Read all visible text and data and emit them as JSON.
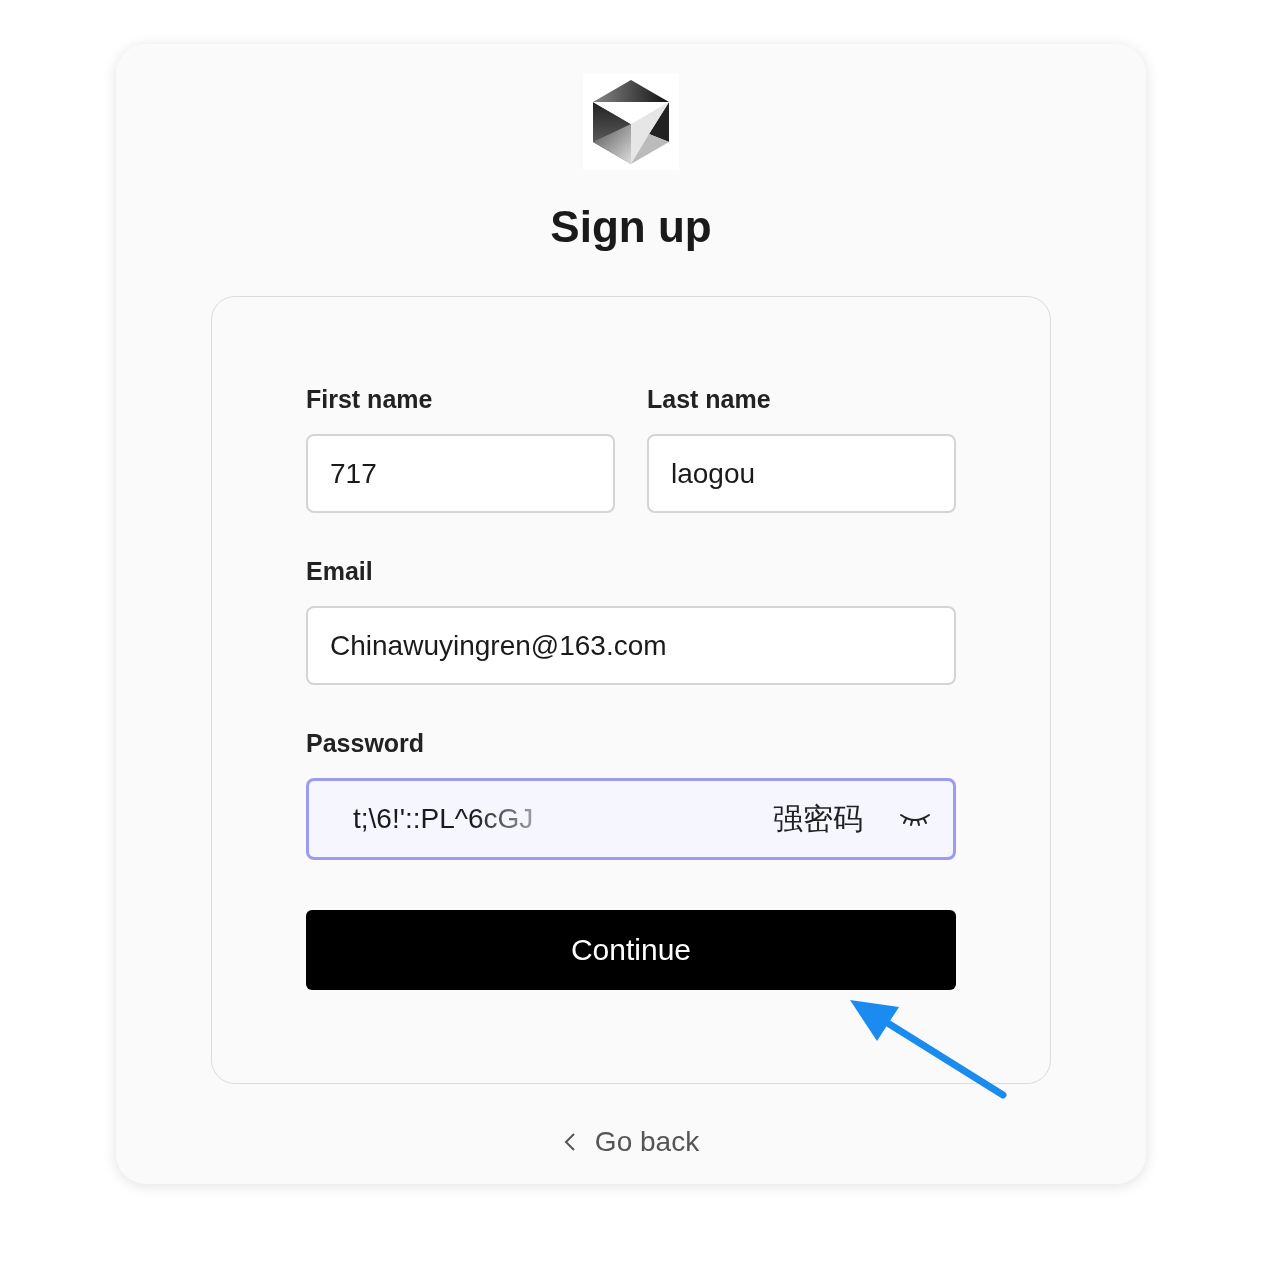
{
  "title": "Sign up",
  "name_fields": [
    {
      "label": "First name",
      "value": "717"
    },
    {
      "label": "Last name",
      "value": "laogou"
    }
  ],
  "email": {
    "label": "Email",
    "value": "Chinawuyingren@163.com"
  },
  "password": {
    "label": "Password",
    "value": "t;\\6!'::PL^6cGJ",
    "strength": "强密码",
    "focused": true
  },
  "continue_button": "Continue",
  "back_link": "Go back"
}
